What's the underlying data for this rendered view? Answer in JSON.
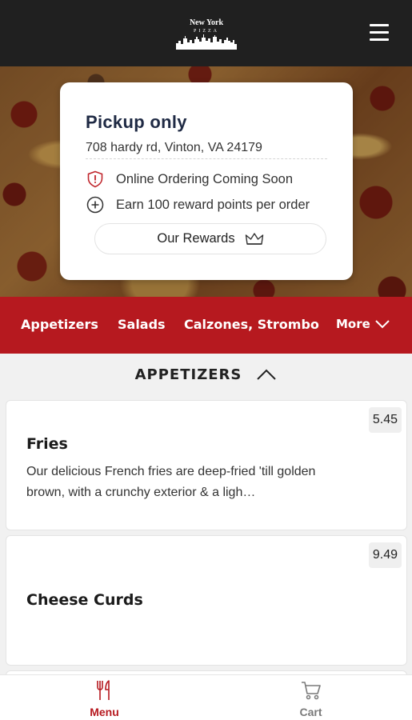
{
  "header": {
    "logo_top": "New York",
    "logo_sub": "PIZZA",
    "menu_icon": "hamburger-icon"
  },
  "info_card": {
    "title": "Pickup only",
    "address": "708 hardy rd, Vinton, VA 24179",
    "notice": "Online Ordering Coming Soon",
    "notice_icon": "alert-shield-icon",
    "rewards_info": "Earn 100 reward points per order",
    "rewards_info_icon": "plus-circle-icon",
    "rewards_button": "Our Rewards",
    "rewards_button_icon": "crown-icon"
  },
  "categories": {
    "items": [
      "Appetizers",
      "Salads",
      "Calzones, Strombo"
    ],
    "more_label": "More"
  },
  "section": {
    "title": "APPETIZERS"
  },
  "menu_items": [
    {
      "name": "Fries",
      "price": "5.45",
      "description": "Our delicious French fries are deep-fried 'till golden brown, with a crunchy exterior & a ligh…"
    },
    {
      "name": "Cheese Curds",
      "price": "9.49"
    }
  ],
  "tabbar": {
    "menu_label": "Menu",
    "cart_label": "Cart"
  },
  "colors": {
    "brand_red": "#b6191f",
    "header_bg": "#202020",
    "title_navy": "#1f2a44"
  }
}
